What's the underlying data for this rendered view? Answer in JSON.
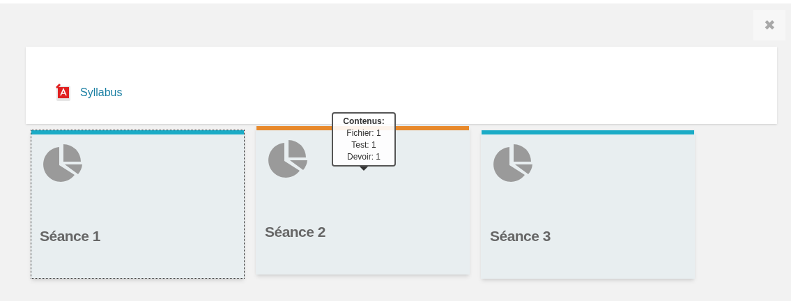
{
  "close_button": {
    "label": "✖"
  },
  "resources": [
    {
      "label": "Syllabus"
    }
  ],
  "sessions": [
    {
      "title": "Séance 1",
      "color": "#1aabc6",
      "focused": true
    },
    {
      "title": "Séance 2",
      "color": "#e8892b",
      "focused": false,
      "tooltip": {
        "heading": "Contenus:",
        "lines": [
          "Fichier: 1",
          "Test: 1",
          "Devoir: 1"
        ]
      }
    },
    {
      "title": "Séance 3",
      "color": "#1aabc6",
      "focused": false
    }
  ]
}
